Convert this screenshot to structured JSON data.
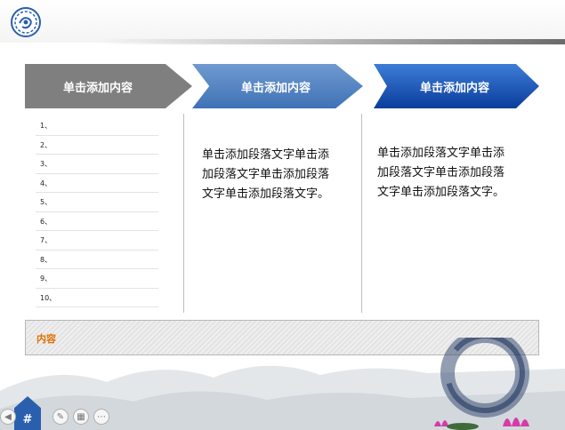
{
  "header": {
    "logo_icon": "emblem-icon"
  },
  "steps": [
    {
      "label": "单击添加内容",
      "color": "#7f7f7f"
    },
    {
      "label": "单击添加内容",
      "color": "#3f72b6"
    },
    {
      "label": "单击添加内容",
      "color": "#0a3d9c"
    }
  ],
  "list": [
    "1、",
    "2、",
    "3、",
    "4、",
    "5、",
    "6、",
    "7、",
    "8、",
    "9、",
    "10、"
  ],
  "paragraphs": [
    "单击添加段落文字单击添加段落文字单击添加段落文字单击添加段落文字。",
    "单击添加段落文字单击添加段落文字单击添加段落文字单击添加段落文字。"
  ],
  "content_box": {
    "label": "内容",
    "accent": "#e07000"
  },
  "footer": {
    "slide_number": "#"
  }
}
